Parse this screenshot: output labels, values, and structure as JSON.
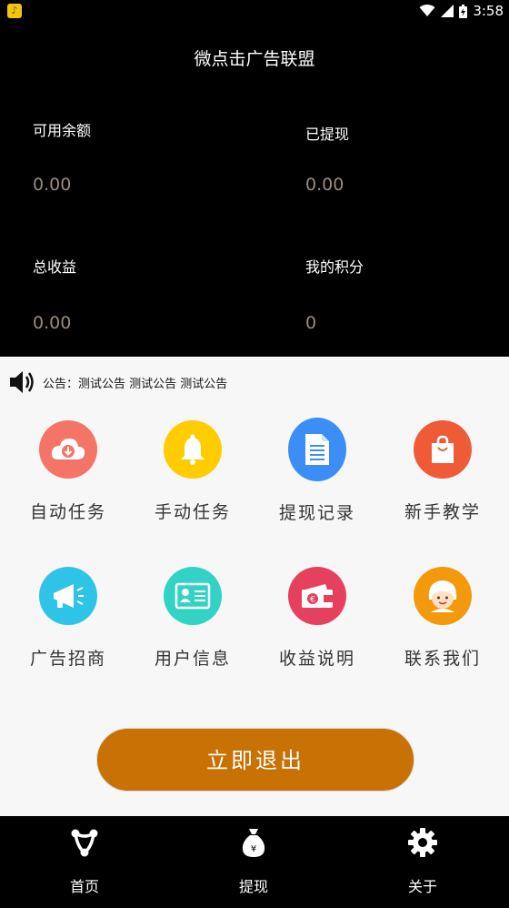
{
  "status_bar": {
    "time": "3:58"
  },
  "app": {
    "title": "微点击广告联盟"
  },
  "stats": [
    {
      "label": "可用余额",
      "value": "0.00"
    },
    {
      "label": "已提现",
      "value": "0.00"
    },
    {
      "label": "总收益",
      "value": "0.00"
    },
    {
      "label": "我的积分",
      "value": "0"
    }
  ],
  "notice": {
    "text": "公告：测试公告 测试公告 测试公告"
  },
  "menu": [
    {
      "label": "自动任务",
      "icon": "cloud-download-icon",
      "color": "#f47567"
    },
    {
      "label": "手动任务",
      "icon": "bell-icon",
      "color": "#ffcc00"
    },
    {
      "label": "提现记录",
      "icon": "document-icon",
      "color": "#3a8ef6"
    },
    {
      "label": "新手教学",
      "icon": "shopping-bag-icon",
      "color": "#ef5a37"
    },
    {
      "label": "广告招商",
      "icon": "megaphone-icon",
      "color": "#2ec4e8"
    },
    {
      "label": "用户信息",
      "icon": "id-card-icon",
      "color": "#32d3c4"
    },
    {
      "label": "收益说明",
      "icon": "wallet-icon",
      "color": "#e5415f"
    },
    {
      "label": "联系我们",
      "icon": "support-agent-icon",
      "color": "#f29a0c"
    }
  ],
  "logout_button": {
    "label": "立即退出",
    "color": "#c87104"
  },
  "bottom_nav": [
    {
      "label": "首页",
      "icon": "home-hub-icon"
    },
    {
      "label": "提现",
      "icon": "money-bag-icon"
    },
    {
      "label": "关于",
      "icon": "gear-icon"
    }
  ]
}
